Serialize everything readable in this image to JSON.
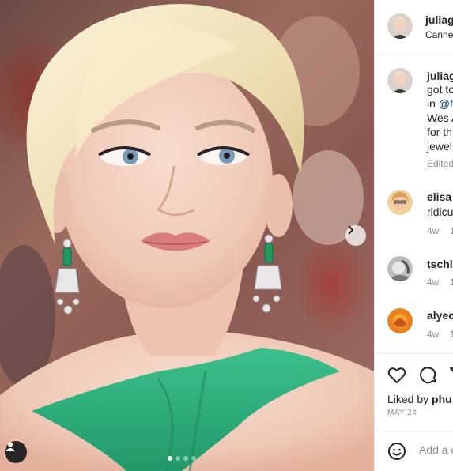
{
  "post": {
    "author": "juliag",
    "location": "Canne",
    "caption_lines": [
      "got to",
      "in ",
      "Wes A",
      "for th",
      "jewel"
    ],
    "caption_mention": "@f",
    "edited": "Edited"
  },
  "carousel": {
    "slide_count": 4,
    "active_index": 0
  },
  "comments": [
    {
      "username": "elisa_",
      "text": "ridicu",
      "age": "4w",
      "likes": "1"
    },
    {
      "username": "tschl",
      "text": "",
      "age": "4w",
      "likes": "1"
    },
    {
      "username": "alyec",
      "text": "",
      "age": "4w",
      "likes": "1"
    }
  ],
  "engagement": {
    "liked_by_prefix": "Liked by ",
    "liked_by_user": "phu",
    "date": "MAY 24"
  },
  "add_comment": {
    "placeholder": "Add a c"
  },
  "icons": [
    "chevron-right-icon",
    "user-tag-icon",
    "heart-icon",
    "comment-icon",
    "share-icon",
    "emoji-icon"
  ],
  "colors": {
    "dress_green": "#2fae7e",
    "emerald": "#1f9a63",
    "mention": "#00376b",
    "meta_gray": "#8e8e8e"
  }
}
